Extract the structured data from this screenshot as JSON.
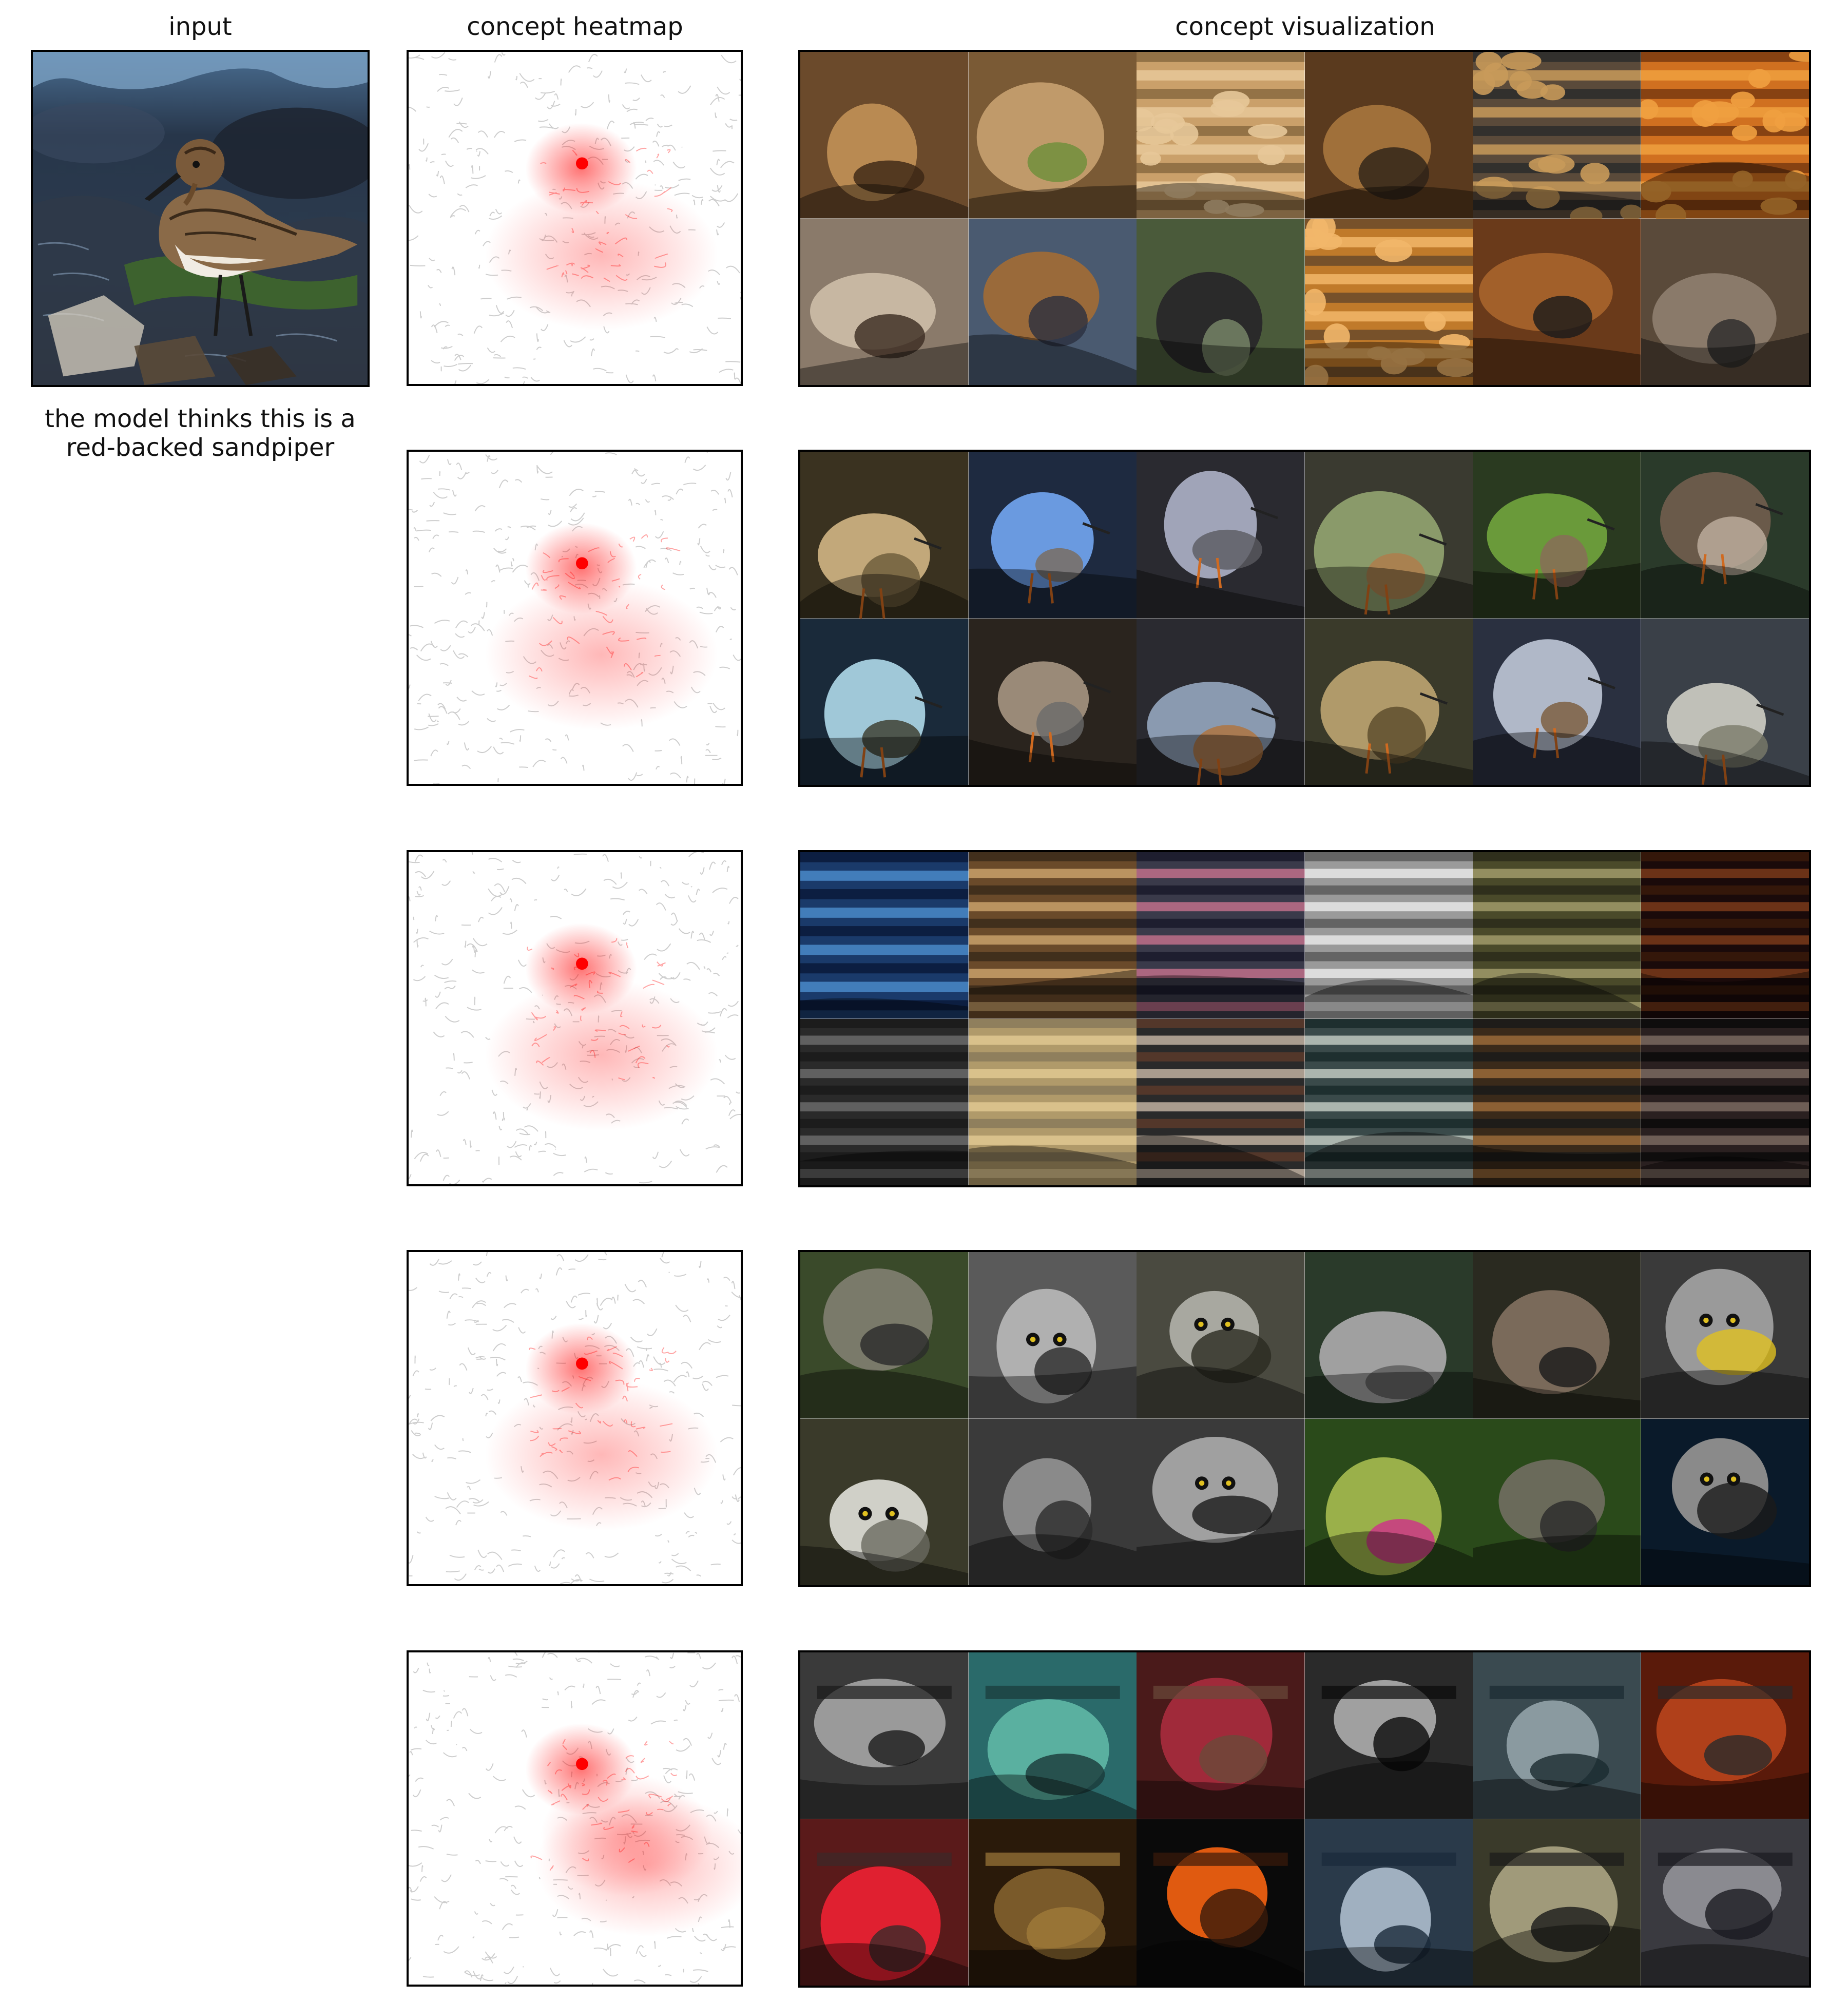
{
  "titles": {
    "input": "input",
    "heatmap": "concept heatmap",
    "visualization": "concept visualization"
  },
  "caption": "the model thinks this is a\nred-backed sandpiper",
  "colors": {
    "heat_red": "#ff0000",
    "edge_gray": "#c8c8c8",
    "border": "#000000"
  },
  "input_image": {
    "subject": "shorebird standing on wet rocks",
    "icon": "sandpiper-photo"
  },
  "concepts": [
    {
      "heat_focus": "head",
      "tiles": [
        {
          "theme": "dog",
          "colors": [
            "#6b4a2b",
            "#b98a52",
            "#3a2414"
          ]
        },
        {
          "theme": "dog",
          "colors": [
            "#7a5a35",
            "#c09a6a",
            "#6c8f3a"
          ]
        },
        {
          "theme": "bread",
          "colors": [
            "#caa06a",
            "#e7c899",
            "#8a6a40"
          ]
        },
        {
          "theme": "dog",
          "colors": [
            "#5a3a1e",
            "#a0703a",
            "#2c2218"
          ]
        },
        {
          "theme": "bakery",
          "colors": [
            "#5a4a3a",
            "#c89a5a",
            "#2b2b2b"
          ]
        },
        {
          "theme": "pastry",
          "colors": [
            "#d07020",
            "#f0a040",
            "#7a3a10"
          ]
        },
        {
          "theme": "dog",
          "colors": [
            "#8a7a6a",
            "#c7b7a2",
            "#3a2a20"
          ]
        },
        {
          "theme": "dog",
          "colors": [
            "#4a5a70",
            "#9a6a3a",
            "#2a3040"
          ]
        },
        {
          "theme": "dog",
          "colors": [
            "#4a5a3a",
            "#2a2a2a",
            "#7a8a6a"
          ]
        },
        {
          "theme": "pastry",
          "colors": [
            "#c07a2a",
            "#f2b76a",
            "#6a4a2a"
          ]
        },
        {
          "theme": "dog",
          "colors": [
            "#6a3a1a",
            "#a2602a",
            "#1a1a1a"
          ]
        },
        {
          "theme": "dog",
          "colors": [
            "#5a4a3a",
            "#8a7a6a",
            "#2a2a2a"
          ]
        }
      ]
    },
    {
      "heat_focus": "head",
      "tiles": [
        {
          "theme": "shorebird",
          "colors": [
            "#3a3220",
            "#c2a87a",
            "#6a5a3a"
          ]
        },
        {
          "theme": "shorebird",
          "colors": [
            "#1e2a40",
            "#6a9ae0",
            "#7a6a5a"
          ]
        },
        {
          "theme": "shorebird",
          "colors": [
            "#2a2a30",
            "#a0a4b8",
            "#5a5a60"
          ]
        },
        {
          "theme": "shorebird",
          "colors": [
            "#3a3a30",
            "#8a9a6a",
            "#b07a4a"
          ]
        },
        {
          "theme": "shorebird",
          "colors": [
            "#2a3a20",
            "#6a9a3a",
            "#8a6a5a"
          ]
        },
        {
          "theme": "shorebird",
          "colors": [
            "#2a3a2a",
            "#6a5a4a",
            "#c0b0a0"
          ]
        },
        {
          "theme": "shorebird",
          "colors": [
            "#1a2a3a",
            "#a0c8d8",
            "#3a3a2a"
          ]
        },
        {
          "theme": "shorebird",
          "colors": [
            "#2a241e",
            "#9a8a78",
            "#6a6a6a"
          ]
        },
        {
          "theme": "shorebird",
          "colors": [
            "#2a2a30",
            "#8a9ab0",
            "#b0723a"
          ]
        },
        {
          "theme": "shorebird",
          "colors": [
            "#3a3a2a",
            "#b09a6a",
            "#5a4a2a"
          ]
        },
        {
          "theme": "shorebird",
          "colors": [
            "#2a3040",
            "#b0b8c8",
            "#7a5a3a"
          ]
        },
        {
          "theme": "shorebird",
          "colors": [
            "#3a4048",
            "#c0c0b8",
            "#7a7a6a"
          ]
        }
      ]
    },
    {
      "heat_focus": "head",
      "tiles": [
        {
          "theme": "stripes",
          "colors": [
            "#1a3a6a",
            "#4a8ac8",
            "#0a1a3a"
          ]
        },
        {
          "theme": "stripes",
          "colors": [
            "#6a4a2a",
            "#c8a06a",
            "#3a2a1a"
          ]
        },
        {
          "theme": "stripes",
          "colors": [
            "#3a3a4a",
            "#c0708a",
            "#1a1a2a"
          ]
        },
        {
          "theme": "stripes",
          "colors": [
            "#9a9a9a",
            "#e8e8e8",
            "#5a5a5a"
          ]
        },
        {
          "theme": "stripes",
          "colors": [
            "#4a4a2a",
            "#a09a6a",
            "#2a2a1a"
          ]
        },
        {
          "theme": "stripes",
          "colors": [
            "#1a0a0a",
            "#7a3a1a",
            "#3a1a0a"
          ]
        },
        {
          "theme": "stripes",
          "colors": [
            "#2a2a2a",
            "#6a6a6a",
            "#1a1a1a"
          ]
        },
        {
          "theme": "stripes",
          "colors": [
            "#b09a6a",
            "#e0c890",
            "#8a7a5a"
          ]
        },
        {
          "theme": "stripes",
          "colors": [
            "#2a2a2a",
            "#c0b0a0",
            "#5a3a2a"
          ]
        },
        {
          "theme": "stripes",
          "colors": [
            "#3a4a4a",
            "#c0c8c0",
            "#1a2a2a"
          ]
        },
        {
          "theme": "stripes",
          "colors": [
            "#3a2a1a",
            "#9a6a3a",
            "#1a1a1a"
          ]
        },
        {
          "theme": "stripes",
          "colors": [
            "#2a2020",
            "#7a6a60",
            "#0a0a0a"
          ]
        }
      ]
    },
    {
      "heat_focus": "head",
      "tiles": [
        {
          "theme": "wolfhound",
          "colors": [
            "#3a4a2a",
            "#7a7a6a",
            "#2a2a2a"
          ]
        },
        {
          "theme": "owl",
          "colors": [
            "#5a5a5a",
            "#b0b0b0",
            "#2a2a2a"
          ]
        },
        {
          "theme": "owl",
          "colors": [
            "#4a4a40",
            "#a8a8a0",
            "#2a2a20"
          ]
        },
        {
          "theme": "wolfhound",
          "colors": [
            "#2a3a2a",
            "#a0a0a0",
            "#5a5a5a"
          ]
        },
        {
          "theme": "wolfhound",
          "colors": [
            "#2a2a20",
            "#7a6a5a",
            "#1a1a1a"
          ]
        },
        {
          "theme": "owl",
          "colors": [
            "#3a3a3a",
            "#9a9a9a",
            "#e0c020"
          ]
        },
        {
          "theme": "owl",
          "colors": [
            "#3a3a2a",
            "#d0d0c8",
            "#6a6a60"
          ]
        },
        {
          "theme": "wolfhound",
          "colors": [
            "#3a3a3a",
            "#8a8a8a",
            "#2a2a2a"
          ]
        },
        {
          "theme": "owl",
          "colors": [
            "#3a3a3a",
            "#a0a0a0",
            "#1a1a1a"
          ]
        },
        {
          "theme": "wolfhound",
          "colors": [
            "#2a4a1a",
            "#9ab04a",
            "#d0308a"
          ]
        },
        {
          "theme": "wolfhound",
          "colors": [
            "#2a4a1a",
            "#6a6a5a",
            "#2a2a2a"
          ]
        },
        {
          "theme": "owl",
          "colors": [
            "#0a1a2a",
            "#8a8a8a",
            "#1a1a1a"
          ]
        }
      ]
    },
    {
      "heat_focus": "body",
      "tiles": [
        {
          "theme": "pot",
          "colors": [
            "#3a3a3a",
            "#9a9a9a",
            "#1a1a1a"
          ]
        },
        {
          "theme": "stove",
          "colors": [
            "#2a6a6a",
            "#5ab0a0",
            "#1a3a3a"
          ]
        },
        {
          "theme": "pot",
          "colors": [
            "#4a1a1a",
            "#a02a3a",
            "#6a4a3a"
          ]
        },
        {
          "theme": "stove",
          "colors": [
            "#2a2a2a",
            "#a0a0a0",
            "#0a0a0a"
          ]
        },
        {
          "theme": "stove",
          "colors": [
            "#3a4a50",
            "#8a9aa0",
            "#1a2a30"
          ]
        },
        {
          "theme": "pot",
          "colors": [
            "#5a1a0a",
            "#b0401a",
            "#2a2a2a"
          ]
        },
        {
          "theme": "pot",
          "colors": [
            "#5a1a1a",
            "#e02030",
            "#3a2a2a"
          ]
        },
        {
          "theme": "pot",
          "colors": [
            "#2a1a0a",
            "#7a5a2a",
            "#a07a3a"
          ]
        },
        {
          "theme": "pot",
          "colors": [
            "#0a0a0a",
            "#e05a10",
            "#3a1a0a"
          ]
        },
        {
          "theme": "pot",
          "colors": [
            "#2a3a4a",
            "#a0b0c0",
            "#1a2a3a"
          ]
        },
        {
          "theme": "pot",
          "colors": [
            "#3a3a2a",
            "#a09a7a",
            "#1a1a1a"
          ]
        },
        {
          "theme": "pot",
          "colors": [
            "#3a3a40",
            "#8a8a90",
            "#1a1a20"
          ]
        }
      ]
    }
  ]
}
